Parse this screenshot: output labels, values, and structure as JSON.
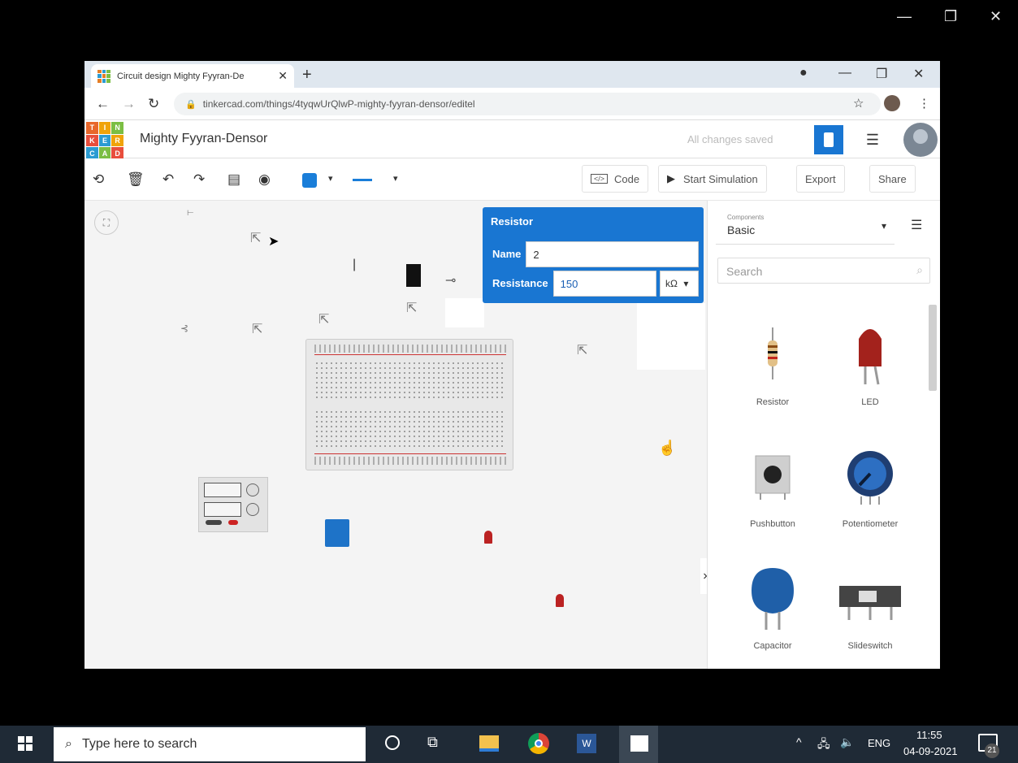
{
  "browser": {
    "tab_title": "Circuit design Mighty Fyyran-De",
    "url": "tinkercad.com/things/4tyqwUrQlwP-mighty-fyyran-densor/editel"
  },
  "app": {
    "project_title": "Mighty Fyyran-Densor",
    "save_status": "All changes saved",
    "logo_letters": [
      "T",
      "I",
      "N",
      "K",
      "E",
      "R",
      "C",
      "A",
      "D"
    ]
  },
  "toolbar": {
    "code_label": "Code",
    "start_simulation_label": "Start Simulation",
    "export_label": "Export",
    "share_label": "Share",
    "color_swatch": "#1a7ed9"
  },
  "inspector": {
    "title": "Resistor",
    "name_label": "Name",
    "name_value": "2",
    "resistance_label": "Resistance",
    "resistance_value": "150",
    "unit": "kΩ"
  },
  "panel": {
    "components_small_label": "Components",
    "components_value": "Basic",
    "search_placeholder": "Search",
    "items": [
      {
        "label": "Resistor"
      },
      {
        "label": "LED"
      },
      {
        "label": "Pushbutton"
      },
      {
        "label": "Potentiometer"
      },
      {
        "label": "Capacitor"
      },
      {
        "label": "Slideswitch"
      }
    ]
  },
  "taskbar": {
    "search_placeholder": "Type here to search",
    "language": "ENG",
    "time": "11:55",
    "date": "04-09-2021",
    "notifications": "21"
  },
  "colors": {
    "accent": "#1976d2",
    "taskbar": "#1f2a36"
  }
}
